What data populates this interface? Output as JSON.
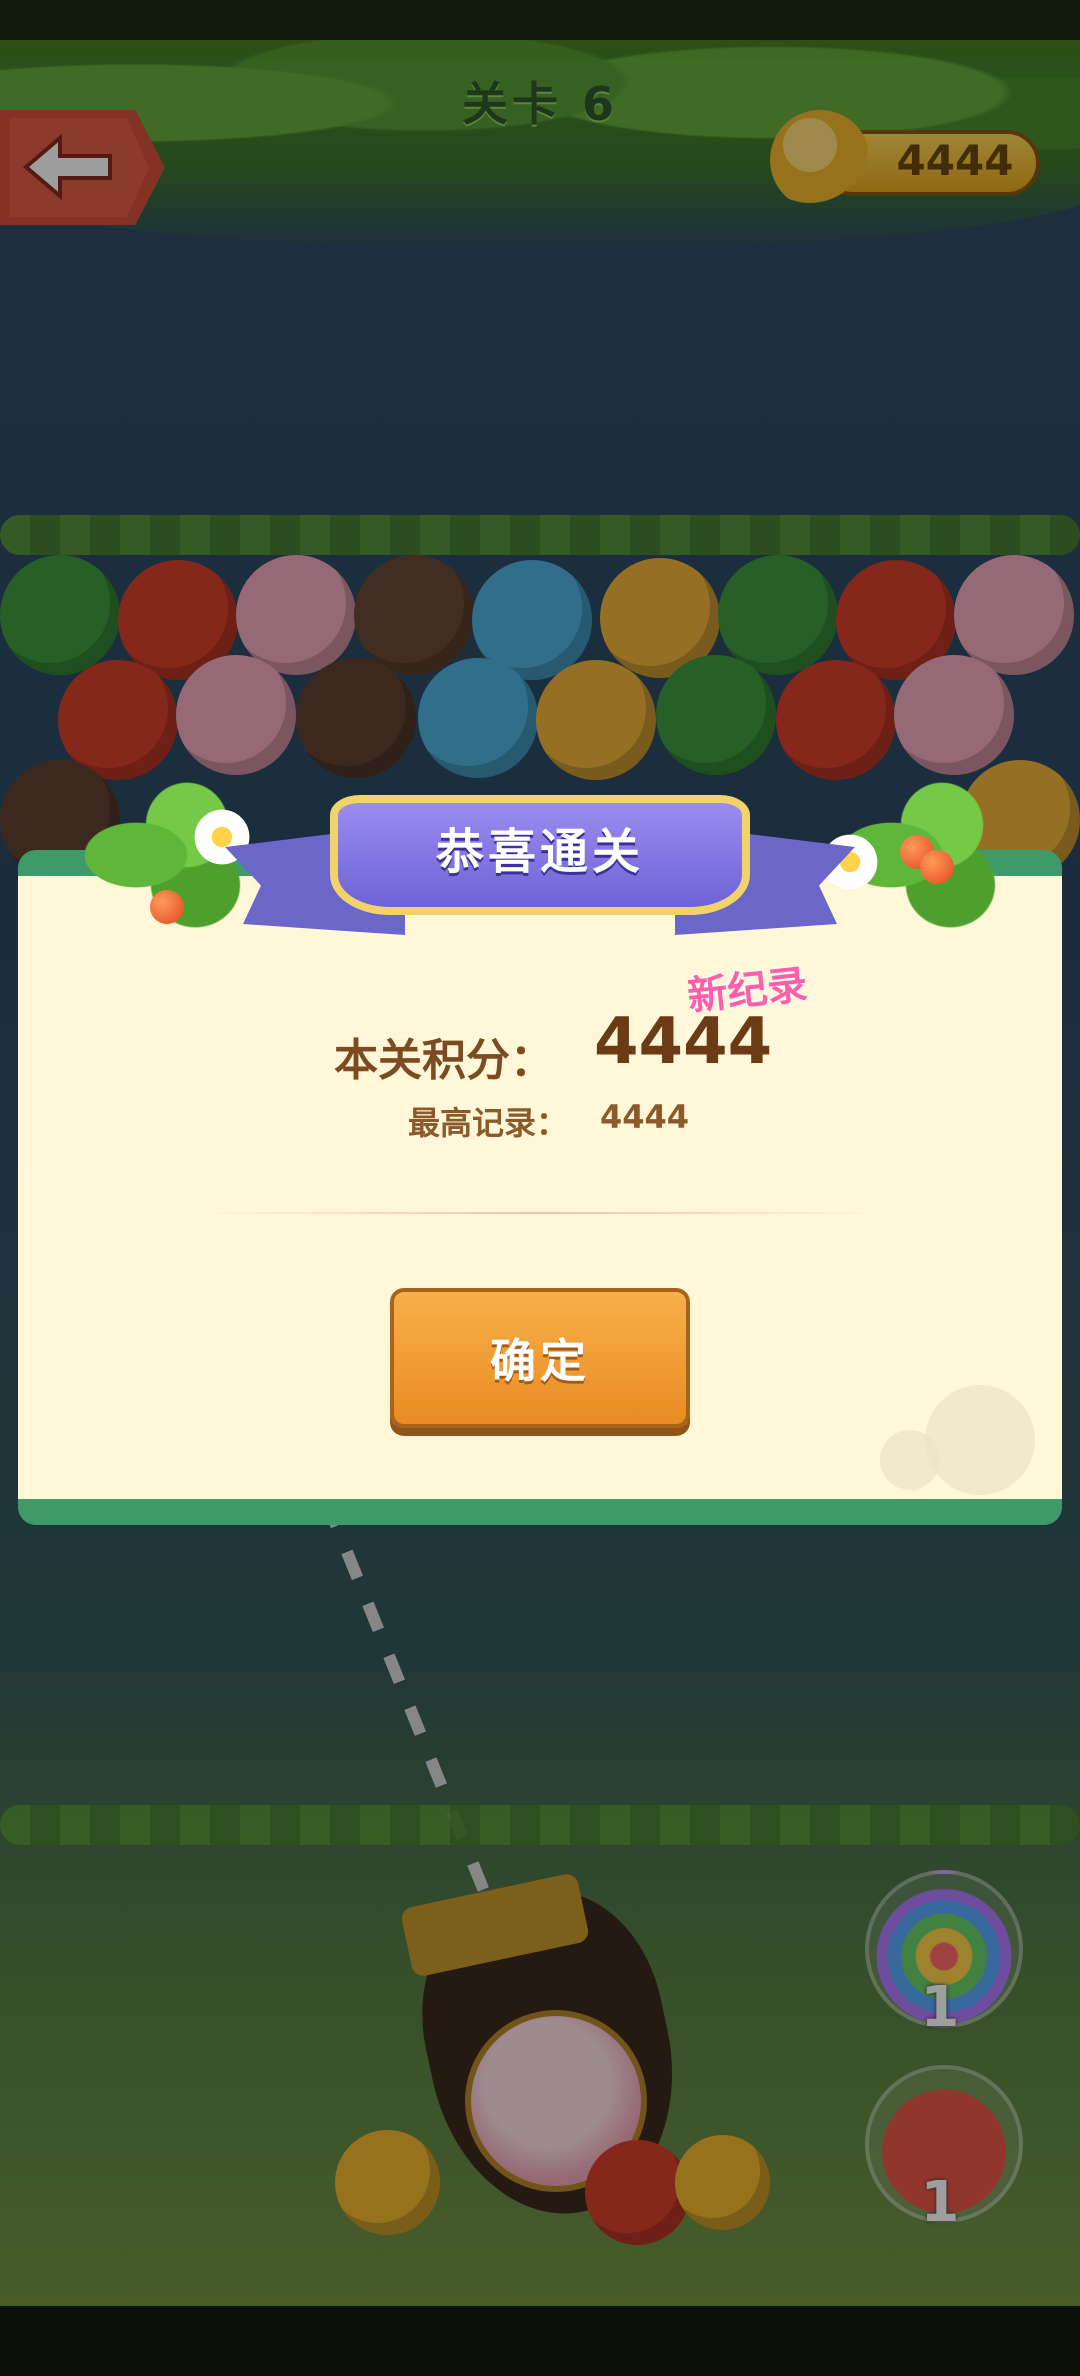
{
  "header": {
    "level_title": "关卡 6",
    "coin_count": "4444"
  },
  "dialog": {
    "title": "恭喜通关",
    "new_record_badge": "新纪录",
    "score_label": "本关积分：",
    "score_value": "4444",
    "best_label": "最高记录：",
    "best_value": "4444",
    "confirm_label": "确定"
  },
  "powerups": [
    {
      "name": "rainbow-bubble",
      "count": "1"
    },
    {
      "name": "fire-bubble",
      "count": "1"
    }
  ],
  "colors": {
    "dialog_bg": "#fff7d8",
    "dialog_border": "#3f9a6a",
    "ribbon": "#6e63d6",
    "confirm_button": "#e98b22",
    "new_record": "#ff5fa8",
    "score_text": "#6a3b14"
  }
}
